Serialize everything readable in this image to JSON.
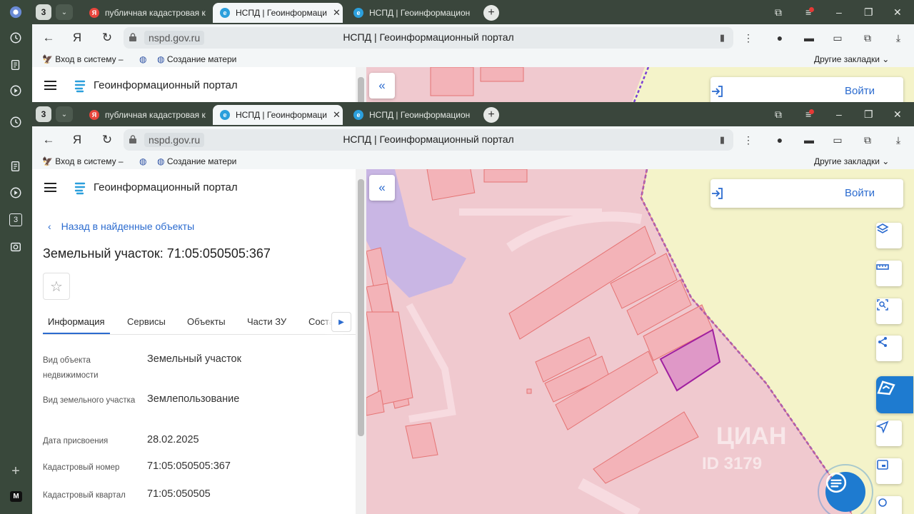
{
  "sidebar": {
    "icons": [
      "yandex-browser-icon",
      "history-icon",
      "collections-icon",
      "video-icon",
      "tabs-count-icon",
      "screenshot-icon",
      "add-icon",
      "m-icon"
    ],
    "tabs_count": "3",
    "m_label": "M"
  },
  "browser": {
    "tab_count": "3",
    "tabs": [
      {
        "title": "публичная кадастровая к",
        "favicon": "Я",
        "color": "#e8453c"
      },
      {
        "title": "НСПД | Геоинформаци",
        "favicon": "e",
        "color": "#2b9fdc"
      },
      {
        "title": "НСПД | Геоинформацион",
        "favicon": "e",
        "color": "#2b9fdc"
      }
    ],
    "domain": "nspd.gov.ru",
    "page_title": "НСПД | Геоинформационный портал",
    "bookmarks": [
      {
        "label": "Вход в систему –"
      },
      {
        "label": ""
      },
      {
        "label": "Создание матери"
      }
    ],
    "other_bookmarks": "Другие закладки"
  },
  "portal": {
    "title": "Геоинформационный портал",
    "back_link": "Назад в найденные объекты",
    "object_title": "Земельный участок: 71:05:050505:367",
    "tabs": [
      "Информация",
      "Сервисы",
      "Объекты",
      "Части ЗУ",
      "Соста"
    ],
    "fields": [
      {
        "key": "Вид объекта недвижимости",
        "value": "Земельный участок"
      },
      {
        "key": "Вид земельного участка",
        "value": "Землепользование"
      },
      {
        "key": "Дата присвоения",
        "value": "28.02.2025"
      },
      {
        "key": "Кадастровый номер",
        "value": "71:05:050505:367"
      },
      {
        "key": "Кадастровый квартал",
        "value": "71:05:050505"
      }
    ]
  },
  "map": {
    "login_label": "Войти",
    "watermark": "ЦИАН",
    "watermark_id": "ID 3179",
    "colors": {
      "zone": "#f0c9cf",
      "parcel": "#ef9a9a",
      "selected": "#d16fc1",
      "boundary": "#7b3fd6",
      "water": "#c9b6e4"
    }
  }
}
